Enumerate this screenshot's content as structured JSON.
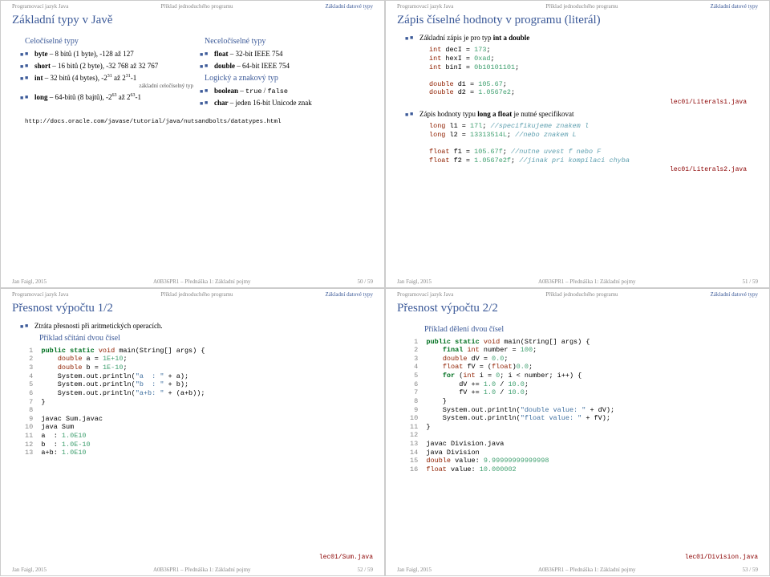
{
  "crumb1": "Programovací jazyk Java",
  "crumb2": "Příklad jednoduchého programu",
  "crumb3": "Základní datové typy",
  "footAuthor": "Jan Faigl, 2015",
  "footMid": "A0B36PR1 – Přednáška 1: Základní pojmy",
  "s1": {
    "title": "Základní typy v Javě",
    "colA_h": "Celočíselné typy",
    "a1a": "byte",
    "a1b": " – 8 bitů (1 byte), -128 až 127",
    "a2a": "short",
    "a2b": " – 16 bitů (2 byte), -32 768 až 32 767",
    "a3a": "int",
    "a3b": " – 32 bitů (4 bytes), -2",
    "a3c": " až 2",
    "a3d": "-1",
    "note1": "základní celočíselný typ",
    "a4a": "long",
    "a4b": " – 64-bitů (8 bajtů), -2",
    "a4c": " až 2",
    "a4d": "-1",
    "colB_h": "Neceločíselné typy",
    "b1a": "float",
    "b1b": " – 32-bit IEEE 754",
    "b2a": "double",
    "b2b": " – 64-bit IEEE 754",
    "colC_h": "Logický a znakový typ",
    "c1a": "boolean",
    "c1b": " – ",
    "c1c": "true",
    "c1d": " / ",
    "c1e": "false",
    "c2a": "char",
    "c2b": " – jeden 16-bit Unicode znak",
    "url": "http://docs.oracle.com/javase/tutorial/java/nutsandbolts/datatypes.html",
    "page": "50 / 59"
  },
  "s2": {
    "title": "Zápis číselné hodnoty v programu (literál)",
    "h1": "Základní zápis je pro typ ",
    "h1b": "int a double",
    "code1": "int decI = 173;\nint hexI = 0xad;\nint binI = 0b10101101;\n\ndouble d1 = 105.67;\ndouble d2 = 1.0567e2;",
    "file1": "lec01/Literals1.java",
    "h2a": "Zápis hodnoty typu ",
    "h2b": "long a float",
    "h2c": " je nutné specifikovat",
    "code2": "long l1 = 17l; //specifikujeme znakem l\nlong l2 = 13313514L; //nebo znakem L\n\nfloat f1 = 105.67f; //nutne uvest f nebo F\nfloat f2 = 1.0567e2f; //jinak pri kompilaci chyba",
    "file2": "lec01/Literals2.java",
    "page": "51 / 59"
  },
  "s3": {
    "title": "Přesnost výpočtu 1/2",
    "b1": "Ztráta přesnosti při aritmetických operacích.",
    "sub": "Příklad sčítání dvou čísel",
    "lines": [
      {
        "n": "1",
        "t": "public static void main(String[] args) {"
      },
      {
        "n": "2",
        "t": "    double a = 1E+10;"
      },
      {
        "n": "3",
        "t": "    double b = 1E-10;"
      },
      {
        "n": "4",
        "t": "    System.out.println(\"a  : \" + a);"
      },
      {
        "n": "5",
        "t": "    System.out.println(\"b  : \" + b);"
      },
      {
        "n": "6",
        "t": "    System.out.println(\"a+b: \" + (a+b));"
      },
      {
        "n": "7",
        "t": "}"
      },
      {
        "n": "8",
        "t": ""
      },
      {
        "n": "9",
        "t": "javac Sum.javac"
      },
      {
        "n": "10",
        "t": "java Sum"
      },
      {
        "n": "11",
        "t": "a  : 1.0E10"
      },
      {
        "n": "12",
        "t": "b  : 1.0E-10"
      },
      {
        "n": "13",
        "t": "a+b: 1.0E10"
      }
    ],
    "file": "lec01/Sum.java",
    "page": "52 / 59"
  },
  "s4": {
    "title": "Přesnost výpočtu 2/2",
    "sub": "Příklad dělení dvou čísel",
    "lines": [
      {
        "n": "1",
        "t": "public static void main(String[] args) {"
      },
      {
        "n": "2",
        "t": "    final int number = 100;"
      },
      {
        "n": "3",
        "t": "    double dV = 0.0;"
      },
      {
        "n": "4",
        "t": "    float fV = (float)0.0;"
      },
      {
        "n": "5",
        "t": "    for (int i = 0; i < number; i++) {"
      },
      {
        "n": "6",
        "t": "        dV += 1.0 / 10.0;"
      },
      {
        "n": "7",
        "t": "        fV += 1.0 / 10.0;"
      },
      {
        "n": "8",
        "t": "    }"
      },
      {
        "n": "9",
        "t": "    System.out.println(\"double value: \" + dV);"
      },
      {
        "n": "10",
        "t": "    System.out.println(\"float value: \" + fV);"
      },
      {
        "n": "11",
        "t": "}"
      },
      {
        "n": "12",
        "t": ""
      },
      {
        "n": "13",
        "t": "javac Division.java"
      },
      {
        "n": "14",
        "t": "java Division"
      },
      {
        "n": "15",
        "t": "double value: 9.99999999999998"
      },
      {
        "n": "16",
        "t": "float value: 10.000002"
      }
    ],
    "file": "lec01/Division.java",
    "page": "53 / 59"
  }
}
